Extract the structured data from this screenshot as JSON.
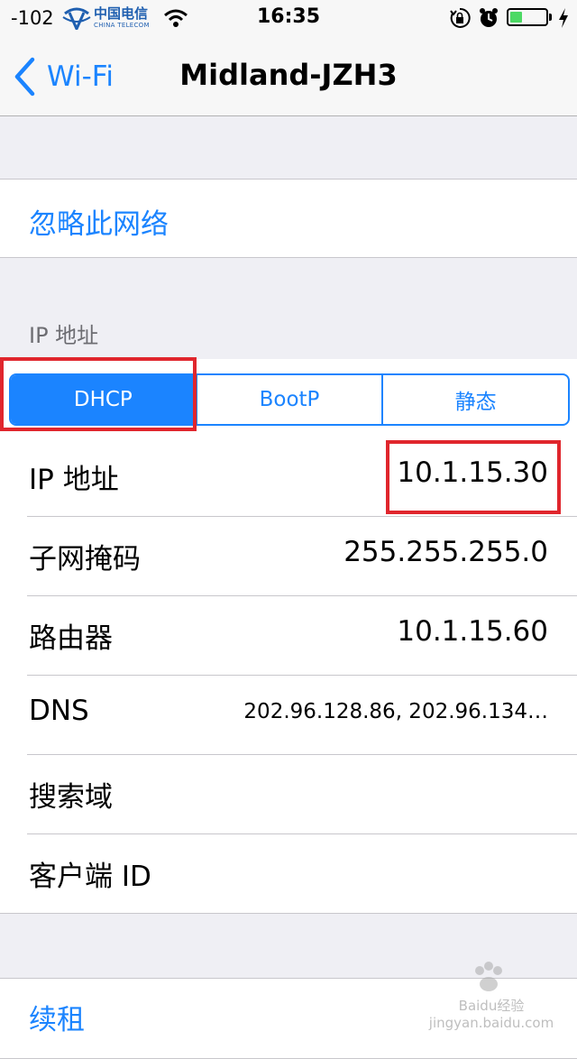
{
  "status_bar": {
    "signal": "-102",
    "carrier_cn": "中国电信",
    "carrier_en": "CHINA TELECOM",
    "time": "16:35",
    "icons": [
      "wifi-icon",
      "orientation-lock-icon",
      "alarm-icon",
      "battery-icon",
      "charging-bolt-icon"
    ],
    "battery_level": 0.35,
    "battery_color": "#4cd964"
  },
  "nav": {
    "back_label": "Wi-Fi",
    "title": "Midland-JZH3"
  },
  "forget_network": "忽略此网络",
  "ip_section_header": "IP 地址",
  "segments": [
    {
      "label": "DHCP",
      "selected": true
    },
    {
      "label": "BootP",
      "selected": false
    },
    {
      "label": "静态",
      "selected": false
    }
  ],
  "fields": [
    {
      "label": "IP 地址",
      "value": "10.1.15.30"
    },
    {
      "label": "子网掩码",
      "value": "255.255.255.0"
    },
    {
      "label": "路由器",
      "value": "10.1.15.60"
    },
    {
      "label": "DNS",
      "value": "202.96.128.86, 202.96.134…"
    },
    {
      "label": "搜索域",
      "value": ""
    },
    {
      "label": "客户端 ID",
      "value": ""
    }
  ],
  "renew_lease": "续租",
  "watermark": "Baidu经验 jingyan.baidu.com",
  "colors": {
    "accent": "#1b84ff",
    "highlight_box": "#e0262d"
  }
}
